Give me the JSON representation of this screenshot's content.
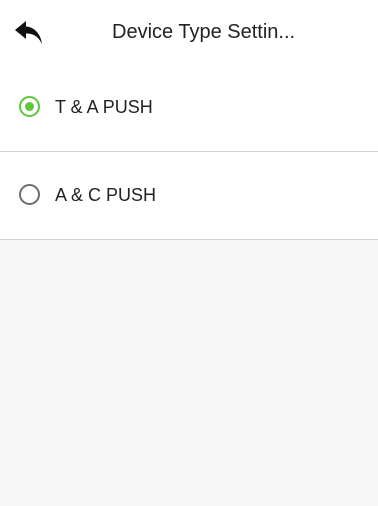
{
  "header": {
    "title": "Device Type Settin...",
    "back_icon": "back-arrow-icon"
  },
  "options": [
    {
      "label": "T & A PUSH",
      "selected": true
    },
    {
      "label": "A & C PUSH",
      "selected": false
    }
  ],
  "colors": {
    "accent": "#5cc93a",
    "background": "#f6f6f6",
    "divider": "#d3d3d3"
  }
}
